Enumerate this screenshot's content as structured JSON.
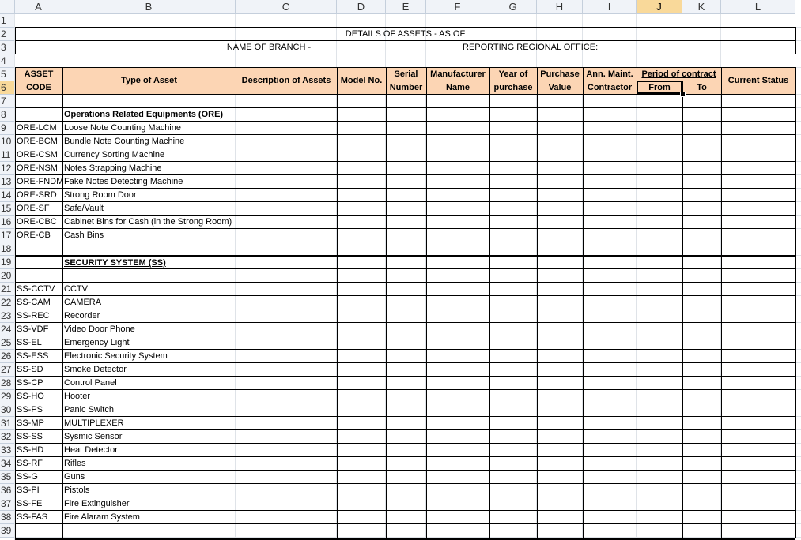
{
  "columns": [
    "A",
    "B",
    "C",
    "D",
    "E",
    "F",
    "G",
    "H",
    "I",
    "J",
    "K",
    "L"
  ],
  "rows": [
    "1",
    "2",
    "3",
    "4",
    "5",
    "6",
    "7",
    "8",
    "9",
    "10",
    "11",
    "12",
    "13",
    "14",
    "15",
    "16",
    "17",
    "18",
    "19",
    "20",
    "21",
    "22",
    "23",
    "24",
    "25",
    "26",
    "27",
    "28",
    "29",
    "30",
    "31",
    "32",
    "33",
    "34",
    "35",
    "36",
    "37",
    "38",
    "39"
  ],
  "title": "DETAILS OF ASSETS - AS OF",
  "branch_label": "NAME OF BRANCH -",
  "regional_label": "REPORTING REGIONAL OFFICE:",
  "headers": {
    "asset_code_1": "ASSET",
    "asset_code_2": "CODE",
    "type": "Type of Asset",
    "description": "Description of Assets",
    "model": "Model No.",
    "serial_1": "Serial",
    "serial_2": "Number",
    "manufacturer_1": "Manufacturer",
    "manufacturer_2": "Name",
    "year_1": "Year of",
    "year_2": "purchase",
    "purchase_1": "Purchase",
    "purchase_2": "Value",
    "amc_1": "Ann. Maint.",
    "amc_2": "Contractor",
    "period": "Period of contract",
    "from": "From",
    "to": "To",
    "status": "Current Status"
  },
  "sections": {
    "ore": "Operations Related Equipments (ORE)",
    "ss": "SECURITY SYSTEM (SS)"
  },
  "ore_items": [
    {
      "code": "ORE-LCM",
      "type": "Loose Note Counting Machine"
    },
    {
      "code": "ORE-BCM",
      "type": "Bundle Note Counting Machine"
    },
    {
      "code": "ORE-CSM",
      "type": "Currency Sorting Machine"
    },
    {
      "code": "ORE-NSM",
      "type": "Notes Strapping Machine"
    },
    {
      "code": "ORE-FNDM",
      "type": "Fake Notes Detecting Machine"
    },
    {
      "code": "ORE-SRD",
      "type": "Strong Room Door"
    },
    {
      "code": "ORE-SF",
      "type": "Safe/Vault"
    },
    {
      "code": "ORE-CBC",
      "type": "Cabinet Bins for Cash (in the Strong Room)"
    },
    {
      "code": "ORE-CB",
      "type": "Cash Bins"
    }
  ],
  "ss_items": [
    {
      "code": "SS-CCTV",
      "type": "CCTV"
    },
    {
      "code": "SS-CAM",
      "type": "CAMERA"
    },
    {
      "code": "SS-REC",
      "type": "Recorder"
    },
    {
      "code": "SS-VDF",
      "type": "Video Door Phone"
    },
    {
      "code": "SS-EL",
      "type": "Emergency Light"
    },
    {
      "code": "SS-ESS",
      "type": "Electronic Security System"
    },
    {
      "code": "SS-SD",
      "type": "Smoke Detector"
    },
    {
      "code": "SS-CP",
      "type": "Control Panel"
    },
    {
      "code": "SS-HO",
      "type": "Hooter"
    },
    {
      "code": "SS-PS",
      "type": "Panic Switch"
    },
    {
      "code": "SS-MP",
      "type": "MULTIPLEXER"
    },
    {
      "code": "SS-SS",
      "type": "Sysmic Sensor"
    },
    {
      "code": "SS-HD",
      "type": "Heat Detector"
    },
    {
      "code": "SS-RF",
      "type": "Rifles"
    },
    {
      "code": "SS-G",
      "type": "Guns"
    },
    {
      "code": "SS-PI",
      "type": "Pistols"
    },
    {
      "code": "SS-FE",
      "type": "Fire Extinguisher"
    },
    {
      "code": "SS-FAS",
      "type": "Fire Alaram System"
    }
  ],
  "selected_cell": "J6",
  "colors": {
    "header_fill": "#fcd5b4",
    "selected_header": "#f9d99a"
  }
}
